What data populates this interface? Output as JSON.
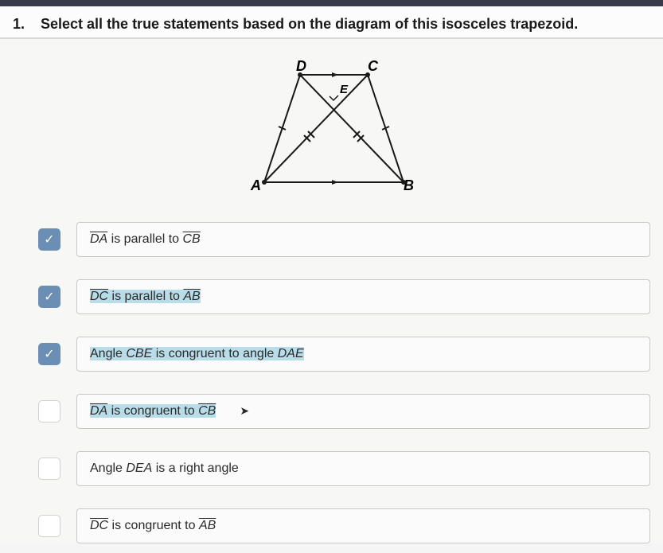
{
  "question": {
    "number": "1.",
    "text": "Select all the true statements based on the diagram of this isosceles trapezoid."
  },
  "diagram": {
    "labels": {
      "topLeft": "D",
      "topRight": "C",
      "bottomLeft": "A",
      "bottomRight": "B",
      "center": "E"
    }
  },
  "options": [
    {
      "checked": true,
      "parts": [
        {
          "text": "DA",
          "overline": true
        },
        {
          "text": " is parallel to "
        },
        {
          "text": "CB",
          "overline": true
        }
      ],
      "highlighted": false
    },
    {
      "checked": true,
      "parts": [
        {
          "text": "DC",
          "overline": true
        },
        {
          "text": " is parallel to "
        },
        {
          "text": "AB",
          "overline": true
        }
      ],
      "highlighted": true
    },
    {
      "checked": true,
      "parts": [
        {
          "text": "Angle "
        },
        {
          "text": "CBE",
          "italic": true
        },
        {
          "text": " is congruent to angle "
        },
        {
          "text": "DAE",
          "italic": true
        }
      ],
      "highlighted": true
    },
    {
      "checked": false,
      "parts": [
        {
          "text": "DA",
          "overline": true
        },
        {
          "text": " is congruent to "
        },
        {
          "text": "CB",
          "overline": true
        }
      ],
      "highlighted": true,
      "hasCursor": true
    },
    {
      "checked": false,
      "parts": [
        {
          "text": "Angle "
        },
        {
          "text": "DEA",
          "italic": true
        },
        {
          "text": " is a right angle"
        }
      ],
      "highlighted": false
    },
    {
      "checked": false,
      "parts": [
        {
          "text": "DC",
          "overline": true
        },
        {
          "text": " is congruent to "
        },
        {
          "text": "AB",
          "overline": true
        }
      ],
      "highlighted": false
    }
  ]
}
